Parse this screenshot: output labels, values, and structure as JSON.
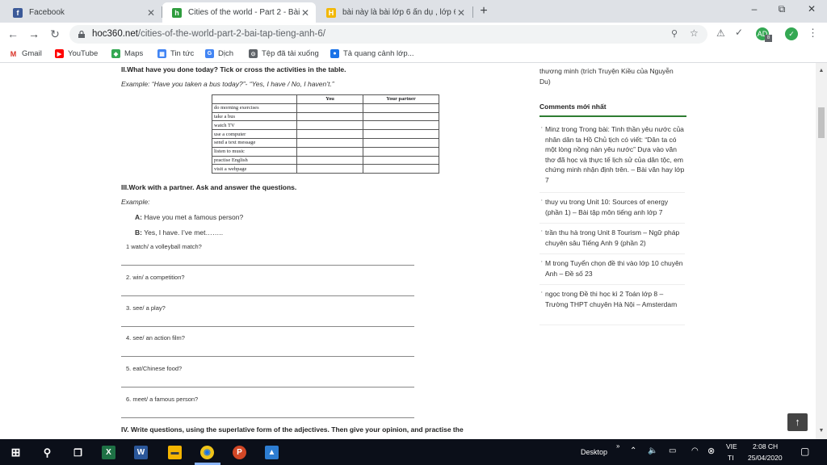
{
  "tabs": [
    {
      "title": "Facebook",
      "icon": "facebook-icon",
      "color": "#3b5998",
      "glyph": "f"
    },
    {
      "title": "Cities of the world - Part 2 - Bài t",
      "icon": "hoc360-icon",
      "color": "#2e9c3d",
      "glyph": "h"
    },
    {
      "title": "bài này là bài lớp 6 ẩn dụ , lớp 6 ...",
      "icon": "hoidap-icon",
      "color": "#f2b705",
      "glyph": "H"
    }
  ],
  "new_tab_label": "+",
  "window_controls": {
    "minimize": "–",
    "restore": "⧉",
    "close": "✕"
  },
  "url": {
    "host": "hoc360.net",
    "path": "/cities-of-the-world-part-2-bai-tap-tieng-anh-6/"
  },
  "profile": {
    "initials": "AD",
    "badge": "8"
  },
  "bookmarks": [
    {
      "label": "Gmail",
      "icon": "gmail-icon",
      "color": "#d93025",
      "glyph": "M"
    },
    {
      "label": "YouTube",
      "icon": "youtube-icon",
      "color": "#ff0000",
      "glyph": "▶"
    },
    {
      "label": "Maps",
      "icon": "maps-icon",
      "color": "#34a853",
      "glyph": "◆"
    },
    {
      "label": "Tin tức",
      "icon": "news-icon",
      "color": "#4285f4",
      "glyph": "▦"
    },
    {
      "label": "Dịch",
      "icon": "translate-icon",
      "color": "#4285f4",
      "glyph": "G"
    },
    {
      "label": "Tệp đã tải xuống",
      "icon": "download-icon",
      "color": "#5f6368",
      "glyph": "⊙"
    },
    {
      "label": "Tả quang cảnh lớp...",
      "icon": "chrome-icon",
      "color": "#1a73e8",
      "glyph": "●"
    }
  ],
  "article": {
    "section2_heading": "II.What have you done today? Tick or cross the activities in the table.",
    "section2_example": "Example: “Have you taken a bus today?”- “Yes, I have / No, I haven’t.”",
    "table": {
      "headers": [
        "",
        "You",
        "Your partner"
      ],
      "rows": [
        "do morning exercises",
        "take a bus",
        "watch TV",
        "use a computer",
        "send a text message",
        "listen to music",
        "practise English",
        "visit a webpage"
      ]
    },
    "section3_heading": "III.Work with a partner. Ask and answer the questions.",
    "example_label": "Example:",
    "example_a_label": "A:",
    "example_a_text": "Have you met a famous person?",
    "example_b_label": "B:",
    "example_b_text": "Yes, I have. I’ve met……..",
    "questions": [
      "1  watch/ a volleyball match?",
      "2. win/ a competition?",
      "3. see/ a play?",
      "4. see/ an action film?",
      "5. eat/Chinese food?",
      "6. meet/ a famous person?"
    ],
    "section4_heading": "IV. Write questions, using the superlative form of the adjectives. Then give your opinion, and practise the"
  },
  "sidebar": {
    "top_text": "thương minh (trích Truyện Kiều của Nguyễn Du)",
    "comments_heading": "Comments mới nhất",
    "comments": [
      "Minz trong Trong bài: Tinh thần yêu nước của nhân dân ta Hồ Chủ tịch có viết: “Dân ta có một lòng nồng nàn yêu nước” Dựa vào văn thơ đã học và thực tế lịch sử của dân tộc, em chứng minh nhận định trên. – Bài văn hay lớp 7",
      "thuy vu trong Unit 10: Sources of energy (phần 1) – Bài tập môn tiếng anh lớp 7",
      "trần thu hà trong Unit 8 Tourism – Ngữ pháp chuyên sâu Tiếng Anh 9 (phần 2)",
      "M trong Tuyển chọn đề thi vào lớp 10 chuyên Anh – Đề số 23",
      "ngọc trong Đề thi học kì 2 Toán lớp 8 – Trường THPT chuyên Hà Nội – Amsterdam"
    ],
    "accent_color": "#2e7d32"
  },
  "back_to_top": "↑",
  "taskbar": {
    "apps": [
      {
        "name": "windows-start-icon",
        "glyph": "⊞",
        "color": "#0b0f19"
      },
      {
        "name": "search-icon",
        "glyph": "⚲",
        "color": "#0b0f19"
      },
      {
        "name": "task-view-icon",
        "glyph": "❐",
        "color": "#0b0f19"
      },
      {
        "name": "excel-icon",
        "glyph": "X",
        "color": "#1e7145"
      },
      {
        "name": "word-icon",
        "glyph": "W",
        "color": "#2b579a"
      },
      {
        "name": "file-explorer-icon",
        "glyph": "▬",
        "color": "#f4b400"
      },
      {
        "name": "chrome-taskbar-icon",
        "glyph": "◉",
        "color": "#f0c419"
      },
      {
        "name": "powerpoint-icon",
        "glyph": "P",
        "color": "#d24726"
      },
      {
        "name": "photos-icon",
        "glyph": "▲",
        "color": "#2d7dd2"
      }
    ],
    "desktop_label": "Desktop",
    "desktop_chevron": "»",
    "lang_top": "VIE",
    "lang_bottom": "TI",
    "time": "2:08 CH",
    "date": "25/04/2020"
  }
}
